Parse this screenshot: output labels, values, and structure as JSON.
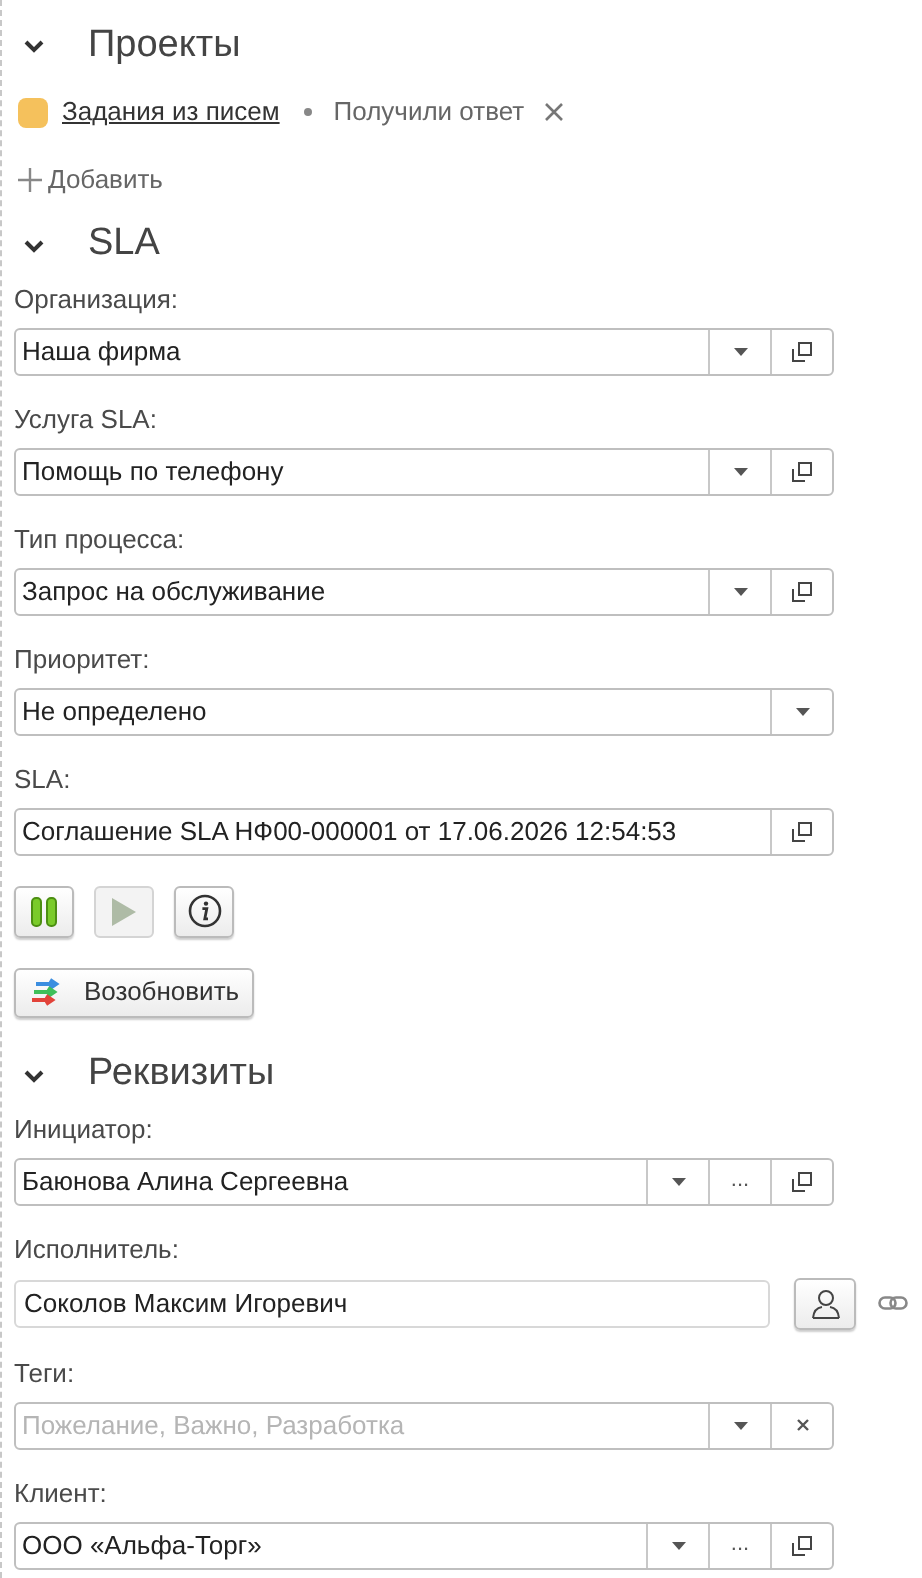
{
  "sections": [
    {
      "title": "Проекты",
      "expanded": true,
      "kind": "projects",
      "projects": [
        {
          "name": "Задания из писем",
          "color": "#f5c15c",
          "status": "Получили ответ"
        }
      ],
      "add_label": "Добавить"
    },
    {
      "title": "SLA",
      "expanded": true,
      "kind": "fields",
      "fields": [
        {
          "label": "Организация:",
          "value": "Наша фирма",
          "buttons": [
            {
              "kind": "dropdown"
            },
            {
              "kind": "open"
            }
          ]
        },
        {
          "label": "Услуга SLA:",
          "value": "Помощь по телефону",
          "buttons": [
            {
              "kind": "dropdown"
            },
            {
              "kind": "open"
            }
          ]
        },
        {
          "label": "Тип процесса:",
          "value": "Запрос на обслуживание",
          "buttons": [
            {
              "kind": "dropdown"
            },
            {
              "kind": "open"
            }
          ]
        },
        {
          "label": "Приоритет:",
          "value": "Не определено",
          "buttons": [
            {
              "kind": "dropdown"
            }
          ]
        },
        {
          "label": "SLA:",
          "value": "Соглашение SLA НФ00-000001 от 17.06.2026 12:54:53",
          "buttons": [
            {
              "kind": "open"
            }
          ]
        }
      ],
      "controls": [
        {
          "kind": "pause",
          "disabled": false
        },
        {
          "kind": "play",
          "disabled": true
        },
        {
          "kind": "info",
          "disabled": false
        }
      ],
      "action": {
        "label": "Возобновить"
      }
    },
    {
      "title": "Реквизиты",
      "expanded": true,
      "kind": "fields",
      "fields": [
        {
          "label": "Инициатор:",
          "value": "Баюнова Алина Сергеевна",
          "buttons": [
            {
              "kind": "dropdown"
            },
            {
              "kind": "ellipsis",
              "label": "..."
            },
            {
              "kind": "open"
            }
          ]
        },
        {
          "label": "Исполнитель:",
          "value": "Соколов Максим Игоревич",
          "kind": "person"
        },
        {
          "label": "Теги:",
          "placeholder": "Пожелание, Важно, Разработка",
          "buttons": [
            {
              "kind": "dropdown"
            },
            {
              "kind": "clear"
            }
          ]
        },
        {
          "label": "Клиент:",
          "value": "ООО «Альфа-Торг»",
          "buttons": [
            {
              "kind": "dropdown"
            },
            {
              "kind": "ellipsis",
              "label": "..."
            },
            {
              "kind": "open"
            }
          ]
        }
      ]
    }
  ]
}
